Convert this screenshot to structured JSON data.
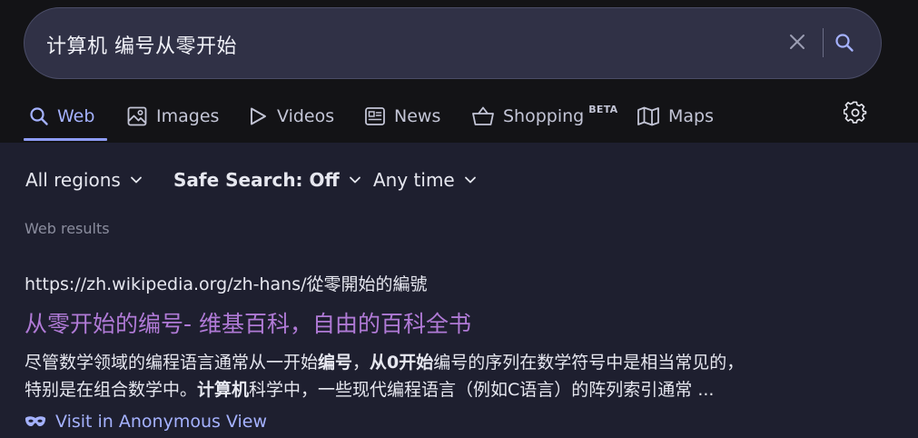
{
  "search": {
    "query": "计算机 编号从零开始"
  },
  "tabs": [
    {
      "label": "Web",
      "icon": "search-icon",
      "active": true
    },
    {
      "label": "Images",
      "icon": "image-icon"
    },
    {
      "label": "Videos",
      "icon": "play-icon"
    },
    {
      "label": "News",
      "icon": "newspaper-icon"
    },
    {
      "label": "Shopping",
      "badge": "BETA",
      "icon": "basket-icon"
    },
    {
      "label": "Maps",
      "icon": "map-icon"
    }
  ],
  "filters": {
    "region": "All regions",
    "safe_search": "Safe Search: Off",
    "time": "Any time"
  },
  "section_label": "Web results",
  "results": [
    {
      "url": "https://zh.wikipedia.org/zh-hans/從零開始的編號",
      "title": "从零开始的编号- 维基百科，自由的百科全书",
      "snippet": {
        "line1_a": "尽管数学领域的编程语言通常从一开始",
        "line1_b": "编号",
        "line1_c": "，",
        "line1_d": "从0开始",
        "line1_e": "编号的序列在数学符号中是相当常见的，",
        "line2_a": "特别是在组合数学中。",
        "line2_b": "计算机",
        "line2_c": "科学中，一些现代编程语言（例如C语言）的阵列索引通常 ..."
      },
      "anonymous_link": "Visit in Anonymous View"
    }
  ],
  "colors": {
    "accent": "#a5b2ff",
    "result_title": "#b07ad6",
    "background": "#1e1f2f",
    "header_bg": "#131316"
  }
}
